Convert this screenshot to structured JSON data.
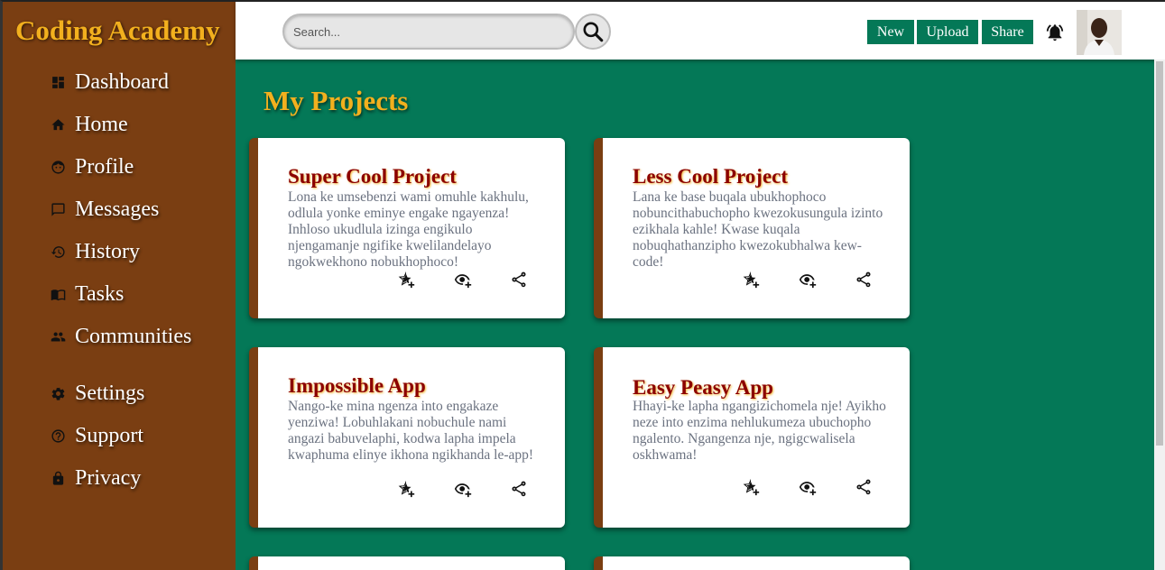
{
  "brand": "Coding Academy",
  "search": {
    "placeholder": "Search..."
  },
  "topbar": {
    "new_label": "New",
    "upload_label": "Upload",
    "share_label": "Share"
  },
  "sidebar": {
    "items": [
      {
        "label": "Dashboard",
        "icon": "dashboard-icon"
      },
      {
        "label": "Home",
        "icon": "home-icon"
      },
      {
        "label": "Profile",
        "icon": "profile-icon"
      },
      {
        "label": "Messages",
        "icon": "message-icon"
      },
      {
        "label": "History",
        "icon": "history-icon"
      },
      {
        "label": "Tasks",
        "icon": "book-icon"
      },
      {
        "label": "Communities",
        "icon": "group-icon"
      },
      {
        "label": "Settings",
        "icon": "gear-icon"
      },
      {
        "label": "Support",
        "icon": "help-icon"
      },
      {
        "label": "Privacy",
        "icon": "lock-icon"
      }
    ]
  },
  "main": {
    "title": "My Projects",
    "projects": [
      {
        "title": "Super Cool Project",
        "description": "Lona ke umsebenzi wami omuhle kakhulu, odlula yonke eminye engake ngayenza! Inhloso ukudlula izinga engikulo njengamanje ngifike kwelilandelayo ngokwekhono nobukhophoco!"
      },
      {
        "title": "Less Cool Project",
        "description": "Lana ke base buqala ubukhophoco nobuncithabuchopho kwezokusungula izinto ezikhala kahle! Kwase kuqala nobuqhathanzipho kwezokubhalwa kew-code!"
      },
      {
        "title": "Impossible App",
        "description": "Nango-ke mina ngenza into engakaze yenziwa! Lobuhlakani nobuchule nami angazi babuvelaphi, kodwa lapha impela kwaphuma elinye ikhona ngikhanda le-app!"
      },
      {
        "title": "Easy Peasy App",
        "description": "Hhayi-ke lapha ngangizichomela nje! Ayikho neze into enzima nehlukumeza ubuchopho ngalento. Ngangenza nje, ngigcwalisela oskhwama!"
      }
    ]
  },
  "colors": {
    "sidebar": "#7a3e12",
    "main": "#047857",
    "accent": "#f2b01e",
    "card_title": "#8b0000"
  }
}
